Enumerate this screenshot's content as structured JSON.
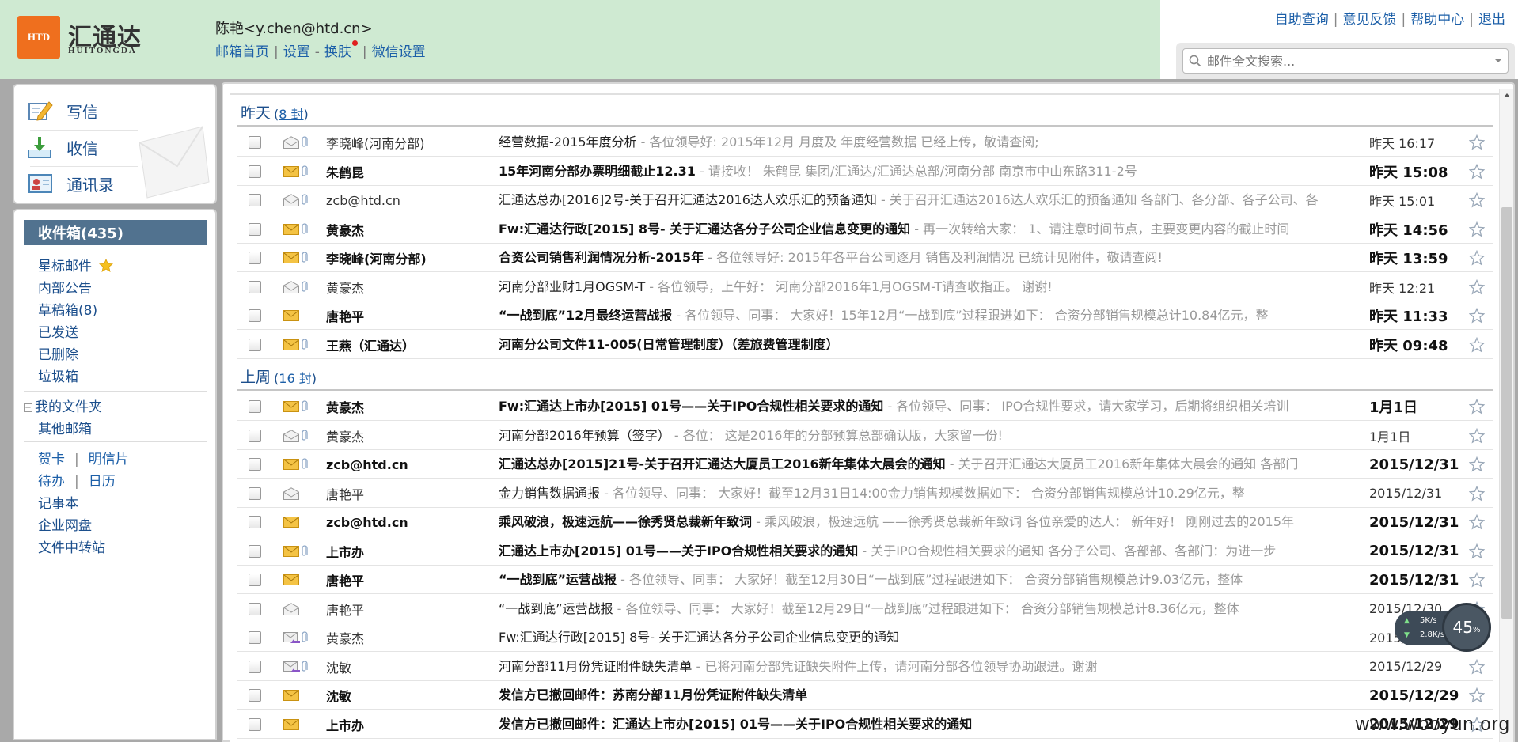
{
  "header": {
    "logo_badge": "HTD",
    "logo_cn": "汇通达",
    "logo_en": "HUITONGDA",
    "user": "陈艳<y.chen@htd.cn>",
    "links": [
      "邮箱首页",
      "设置",
      "换肤",
      "微信设置"
    ],
    "top_links": [
      "自助查询",
      "意见反馈",
      "帮助中心",
      "退出"
    ],
    "search_placeholder": "邮件全文搜索..."
  },
  "compose": {
    "write": "写信",
    "receive": "收信",
    "contacts": "通讯录"
  },
  "nav": {
    "inbox": "收件箱(435)",
    "starred": "星标邮件",
    "internal": "内部公告",
    "drafts": "草稿箱(8)",
    "sent": "已发送",
    "deleted": "已删除",
    "junk": "垃圾箱",
    "my_folders": "我的文件夹",
    "other_mail": "其他邮箱",
    "card": "贺卡",
    "postcard": "明信片",
    "todo": "待办",
    "calendar": "日历",
    "notebook": "记事本",
    "netdisk": "企业网盘",
    "transfer": "文件中转站"
  },
  "groups": [
    {
      "title": "昨天",
      "count": "8 封",
      "mails": [
        {
          "from": "李晓峰(河南分部)",
          "subject": "经营数据-2015年度分析",
          "preview": " - 各位领导好: 2015年12月 月度及 年度经营数据 已经上传，敬请查阅;",
          "time": "昨天 16:17",
          "unread": false,
          "clip": true,
          "type": "read"
        },
        {
          "from": "朱鹤昆",
          "subject": "15年河南分部办票明细截止12.31",
          "preview": " - 请接收！ 朱鹤昆 集团/汇通达/汇通达总部/河南分部 南京市中山东路311-2号",
          "time": "昨天 15:08",
          "unread": true,
          "clip": true,
          "type": "unread"
        },
        {
          "from": "zcb@htd.cn",
          "subject": "汇通达总办[2016]2号-关于召开汇通达2016达人欢乐汇的预备通知",
          "preview": " - 关于召开汇通达2016达人欢乐汇的预备通知 各部门、各分部、各子公司、各",
          "time": "昨天 15:01",
          "unread": false,
          "clip": true,
          "type": "read"
        },
        {
          "from": "黄豪杰",
          "subject": "Fw:汇通达行政[2015] 8号- 关于汇通达各分子公司企业信息变更的通知",
          "preview": " - 再一次转给大家： 1、请注意时间节点，主要变更内容的截止时间",
          "time": "昨天 14:56",
          "unread": true,
          "clip": true,
          "type": "unread"
        },
        {
          "from": "李晓峰(河南分部)",
          "subject": "合资公司销售利润情况分析-2015年",
          "preview": " - 各位领导好: 2015年各平台公司逐月 销售及利润情况 已统计见附件，敬请查阅!",
          "time": "昨天 13:59",
          "unread": true,
          "clip": true,
          "type": "unread"
        },
        {
          "from": "黄豪杰",
          "subject": "河南分部业财1月OGSM-T",
          "preview": " - 各位领导，上午好： 河南分部2016年1月OGSM-T请查收指正。 谢谢!",
          "time": "昨天 12:21",
          "unread": false,
          "clip": true,
          "type": "read"
        },
        {
          "from": "唐艳平",
          "subject": "“一战到底”12月最终运营战报",
          "preview": " -  各位领导、同事： 大家好！15年12月“一战到底”过程跟进如下： 合资分部销售规模总计10.84亿元，整",
          "time": "昨天 11:33",
          "unread": true,
          "clip": false,
          "type": "unread"
        },
        {
          "from": "王燕（汇通达）",
          "subject": "河南分公司文件11-005(日常管理制度）（差旅费管理制度）",
          "preview": "",
          "time": "昨天 09:48",
          "unread": true,
          "clip": true,
          "type": "unread"
        }
      ]
    },
    {
      "title": "上周",
      "count": "16 封",
      "mails": [
        {
          "from": "黄豪杰",
          "subject": "Fw:汇通达上市办[2015] 01号——关于IPO合规性相关要求的通知",
          "preview": " - 各位领导、同事： IPO合规性要求，请大家学习，后期将组织相关培训",
          "time": "1月1日",
          "unread": true,
          "clip": true,
          "type": "unread"
        },
        {
          "from": "黄豪杰",
          "subject": "河南分部2016年预算（签字）",
          "preview": " - 各位： 这是2016年的分部预算总部确认版，大家留一份!",
          "time": "1月1日",
          "unread": false,
          "clip": true,
          "type": "read"
        },
        {
          "from": "zcb@htd.cn",
          "subject": "汇通达总办[2015]21号-关于召开汇通达大厦员工2016新年集体大晨会的通知",
          "preview": " - 关于召开汇通达大厦员工2016新年集体大晨会的通知 各部门",
          "time": "2015/12/31",
          "unread": true,
          "clip": true,
          "type": "unread"
        },
        {
          "from": "唐艳平",
          "subject": "金力销售数据通报",
          "preview": " -  各位领导、同事： 大家好！截至12月31日14:00金力销售规模数据如下： 合资分部销售规模总计10.29亿元，整",
          "time": "2015/12/31",
          "unread": false,
          "clip": false,
          "type": "read"
        },
        {
          "from": "zcb@htd.cn",
          "subject": "乘风破浪，极速远航——徐秀贤总裁新年致词",
          "preview": " -  乘风破浪，极速远航 ——徐秀贤总裁新年致词 各位亲爱的达人： 新年好！ 刚刚过去的2015年",
          "time": "2015/12/31",
          "unread": true,
          "clip": false,
          "type": "unread"
        },
        {
          "from": "上市办",
          "subject": "汇通达上市办[2015] 01号——关于IPO合规性相关要求的通知",
          "preview": " - 关于IPO合规性相关要求的通知 各分子公司、各部部、各部门：为进一步",
          "time": "2015/12/31",
          "unread": true,
          "clip": true,
          "type": "unread"
        },
        {
          "from": "唐艳平",
          "subject": "“一战到底”运营战报",
          "preview": " -  各位领导、同事： 大家好！截至12月30日“一战到底”过程跟进如下： 合资分部销售规模总计9.03亿元，整体",
          "time": "2015/12/31",
          "unread": true,
          "clip": false,
          "type": "unread"
        },
        {
          "from": "唐艳平",
          "subject": "“一战到底”运营战报",
          "preview": " -  各位领导、同事： 大家好！截至12月29日“一战到底”过程跟进如下： 合资分部销售规模总计8.36亿元，整体",
          "time": "2015/12/30",
          "unread": false,
          "clip": false,
          "type": "read"
        },
        {
          "from": "黄豪杰",
          "subject": "Fw:汇通达行政[2015] 8号- 关于汇通达各分子公司企业信息变更的通知",
          "preview": "",
          "time": "2015/12/29",
          "unread": false,
          "clip": true,
          "type": "forward"
        },
        {
          "from": "沈敏",
          "subject": "河南分部11月份凭证附件缺失清单",
          "preview": " - 已将河南分部凭证缺失附件上传，请河南分部各位领导协助跟进。谢谢",
          "time": "2015/12/29",
          "unread": false,
          "clip": true,
          "type": "forward"
        },
        {
          "from": "沈敏",
          "subject": "发信方已撤回邮件：苏南分部11月份凭证附件缺失清单",
          "preview": "",
          "time": "2015/12/29",
          "unread": true,
          "clip": false,
          "type": "unread"
        },
        {
          "from": "上市办",
          "subject": "发信方已撤回邮件：汇通达上市办[2015] 01号——关于IPO合规性相关要求的通知",
          "preview": "",
          "time": "2015/12/29",
          "unread": true,
          "clip": false,
          "type": "unread"
        }
      ]
    }
  ],
  "speed": {
    "up": "5K/s",
    "down": "2.8K/s",
    "percent": "45",
    "percent_unit": "%"
  },
  "watermark": "www.wooyun.org",
  "colors": {
    "header_bg": "#cfead2",
    "logo": "#ef6f1e",
    "inbox_active": "#51728f",
    "link": "#1c5fa8"
  }
}
